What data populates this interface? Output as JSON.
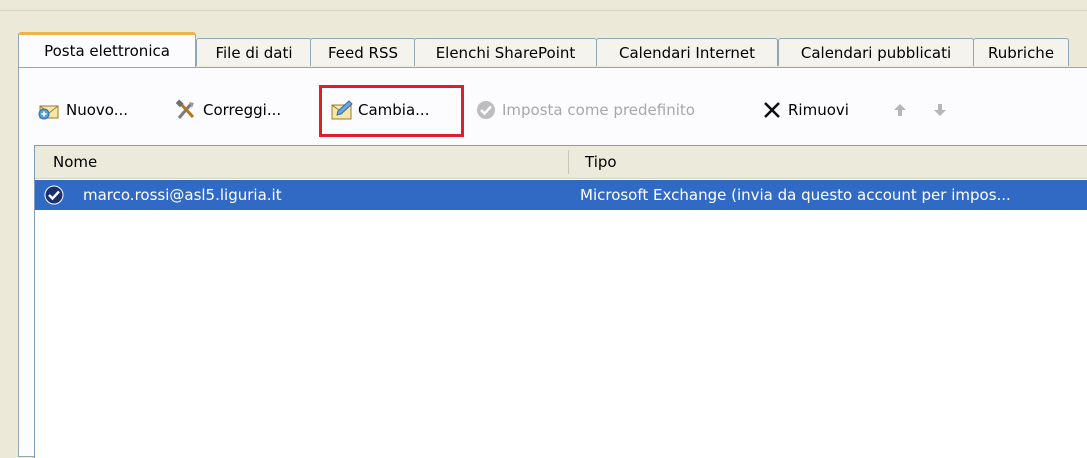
{
  "tabs": [
    {
      "label": "Posta elettronica",
      "active": true
    },
    {
      "label": "File di dati",
      "active": false
    },
    {
      "label": "Feed RSS",
      "active": false
    },
    {
      "label": "Elenchi SharePoint",
      "active": false
    },
    {
      "label": "Calendari Internet",
      "active": false
    },
    {
      "label": "Calendari pubblicati",
      "active": false
    },
    {
      "label": "Rubriche",
      "active": false
    }
  ],
  "toolbar": {
    "new_label": "Nuovo...",
    "repair_label": "Correggi...",
    "change_label": "Cambia...",
    "set_default_label": "Imposta come predefinito",
    "remove_label": "Rimuovi",
    "icons": [
      "new-account-icon",
      "repair-tools-icon",
      "change-account-icon",
      "checkmark-icon",
      "remove-x-icon",
      "move-up-arrow-icon",
      "move-down-arrow-icon"
    ]
  },
  "list": {
    "columns": [
      "Nome",
      "Tipo"
    ],
    "rows": [
      {
        "name": "marco.rossi@asl5.liguria.it",
        "type": "Microsoft Exchange (invia da questo account per impos...",
        "selected": true,
        "default": true
      }
    ]
  },
  "colors": {
    "selection": "#316ac5",
    "highlight_box": "#e01e2a",
    "active_tab_accent": "#f1b24c"
  }
}
